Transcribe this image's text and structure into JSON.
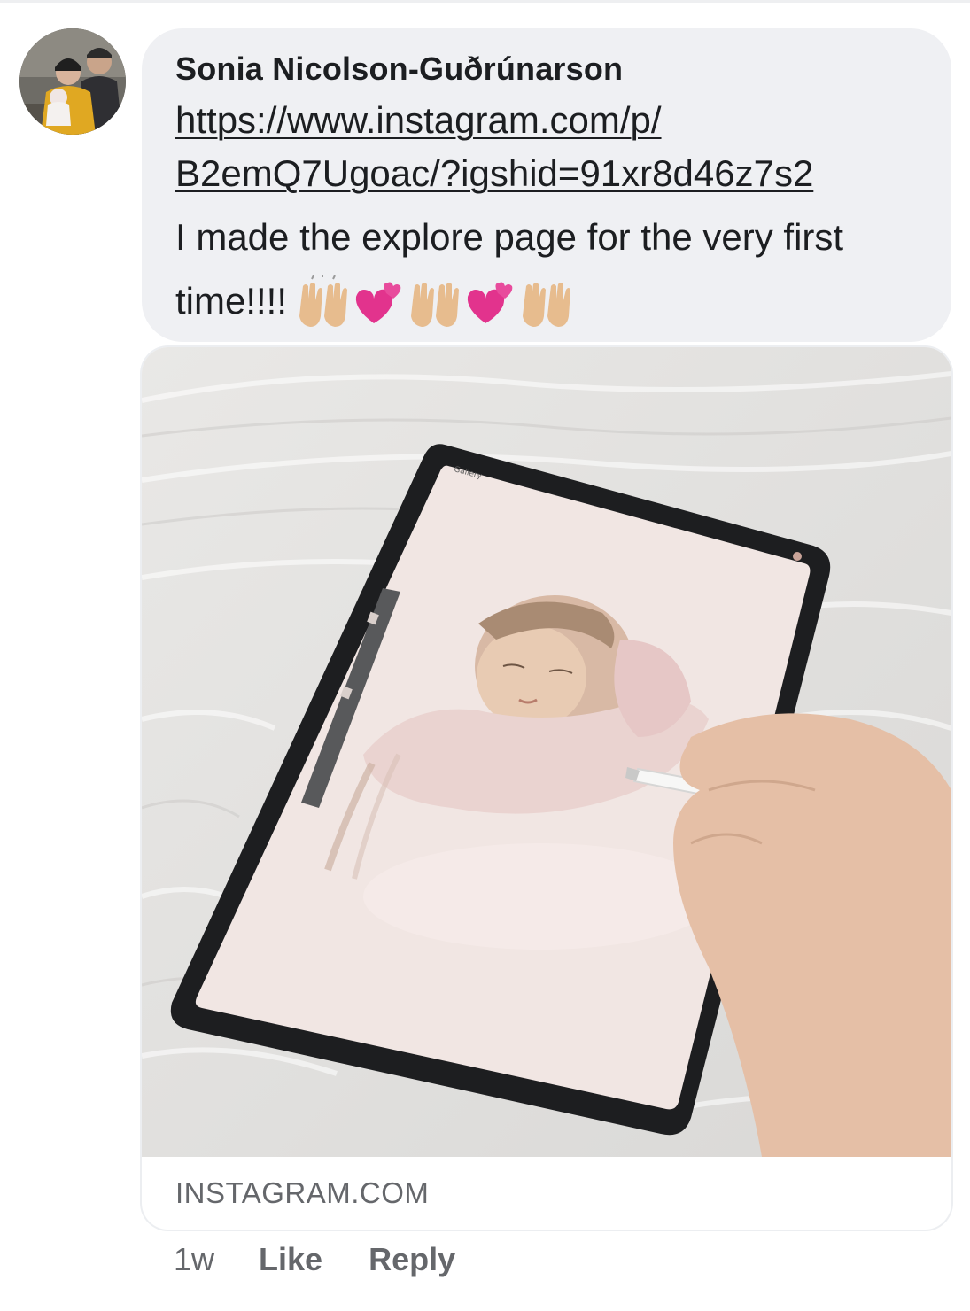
{
  "comment": {
    "author": "Sonia Nicolson-Guðrúnarson",
    "link_line_1": "https://www.instagram.com/p/",
    "link_line_2": "B2emQ7Ugoac/?igshid=91xr8d46z7s2",
    "text": "I made the explore page for the very first time!!!!",
    "emojis": [
      "raising-hands-emoji",
      "two-hearts-emoji",
      "raising-hands-emoji",
      "two-hearts-emoji",
      "raising-hands-emoji"
    ]
  },
  "link_preview": {
    "domain": "INSTAGRAM.COM",
    "image": "tablet-drawing-of-newborn-baby",
    "tablet_toolbar_label": "Gallery"
  },
  "actions": {
    "time": "1w",
    "like_label": "Like",
    "reply_label": "Reply"
  },
  "colors": {
    "bubble_bg": "#eff0f3",
    "meta_text": "#65676b",
    "primary_text": "#1c1e21"
  }
}
